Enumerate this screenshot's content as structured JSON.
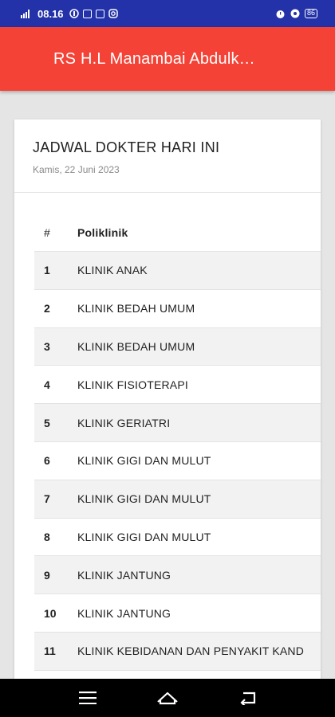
{
  "status_bar": {
    "time": "08.16",
    "battery": "86",
    "colors": {
      "background": "#2332a8"
    }
  },
  "app_bar": {
    "title": "RS H.L Manambai Abdulk…",
    "color": "#f44336"
  },
  "card": {
    "title": "JADWAL DOKTER HARI INI",
    "date": "Kamis, 22 Juni 2023"
  },
  "table": {
    "headers": {
      "num": "#",
      "poli": "Poliklinik"
    },
    "rows": [
      {
        "num": "1",
        "poli": "KLINIK ANAK"
      },
      {
        "num": "2",
        "poli": "KLINIK BEDAH UMUM"
      },
      {
        "num": "3",
        "poli": "KLINIK BEDAH UMUM"
      },
      {
        "num": "4",
        "poli": "KLINIK FISIOTERAPI"
      },
      {
        "num": "5",
        "poli": "KLINIK GERIATRI"
      },
      {
        "num": "6",
        "poli": "KLINIK GIGI DAN MULUT"
      },
      {
        "num": "7",
        "poli": "KLINIK GIGI DAN MULUT"
      },
      {
        "num": "8",
        "poli": "KLINIK GIGI DAN MULUT"
      },
      {
        "num": "9",
        "poli": "KLINIK JANTUNG"
      },
      {
        "num": "10",
        "poli": "KLINIK JANTUNG"
      },
      {
        "num": "11",
        "poli": "KLINIK KEBIDANAN DAN PENYAKIT KAND"
      }
    ]
  },
  "nav_bar": {
    "icons": [
      "menu-icon",
      "home-icon",
      "back-icon"
    ]
  }
}
